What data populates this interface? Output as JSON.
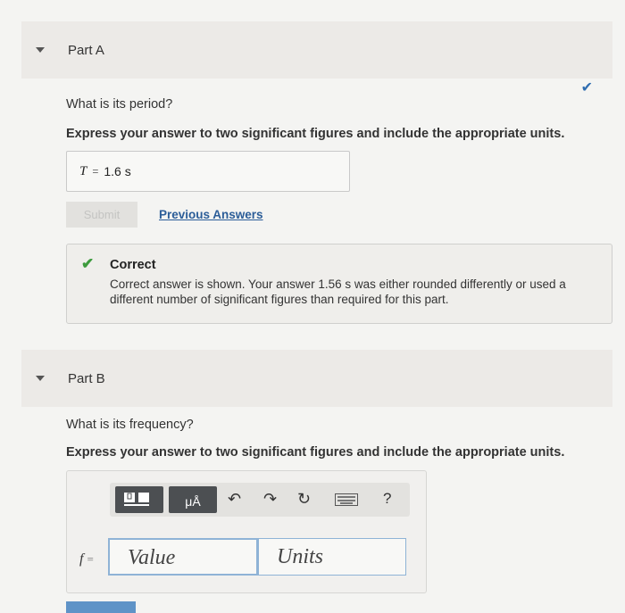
{
  "part_a": {
    "title": "Part A",
    "question": "What is its period?",
    "instruction": "Express your answer to two significant figures and include the appropriate units.",
    "answer": {
      "variable": "T",
      "equals": "=",
      "value": "1.6 s"
    },
    "submit_label": "Submit",
    "previous_answers_label": "Previous Answers",
    "feedback": {
      "title": "Correct",
      "body": "Correct answer is shown. Your answer 1.56 s was either rounded differently or used a different number of significant figures than required for this part."
    }
  },
  "part_b": {
    "title": "Part B",
    "question": "What is its frequency?",
    "instruction": "Express your answer to two significant figures and include the appropriate units.",
    "variable": "f",
    "equals": "=",
    "value_placeholder": "Value",
    "units_placeholder": "Units",
    "toolbar": {
      "units_button_label": "μÅ",
      "help_label": "?"
    }
  },
  "colors": {
    "accent": "#2b5d98",
    "correct": "#3d9b3d"
  }
}
